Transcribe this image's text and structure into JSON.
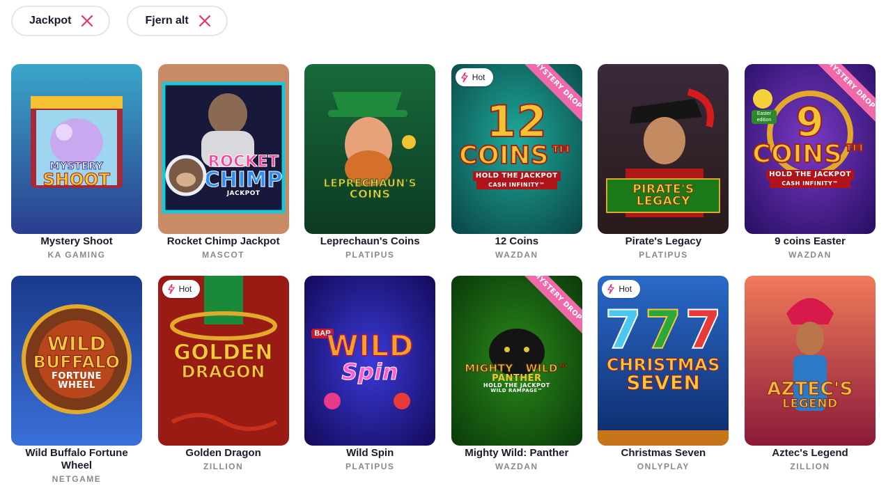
{
  "filters": [
    {
      "label": "Jackpot",
      "icon": "close-icon"
    },
    {
      "label": "Fjern alt",
      "icon": "close-icon"
    }
  ],
  "colors": {
    "accent": "#e7326e",
    "hot_ribbon": "#f06aa9",
    "provider_text": "#8a8795"
  },
  "hot_label": "Hot",
  "games": [
    {
      "title": "Mystery Shoot",
      "provider": "KA GAMING",
      "logo": [
        "MYSTERY",
        "SHOOT"
      ],
      "hot": false,
      "mystery_drop": false
    },
    {
      "title": "Rocket Chimp Jackpot",
      "provider": "MASCOT",
      "logo": [
        "ROCKET",
        "CHIMP",
        "JACKPOT"
      ],
      "hot": false,
      "mystery_drop": false
    },
    {
      "title": "Leprechaun's Coins",
      "provider": "PLATIPUS",
      "logo": [
        "LEPRECHAUN'S",
        "COINS"
      ],
      "hot": false,
      "mystery_drop": false
    },
    {
      "title": "12 Coins",
      "provider": "WAZDAN",
      "logo": [
        "12",
        "COINS™",
        "HOLD THE JACKPOT",
        "CASH INFINITY™"
      ],
      "hot": true,
      "mystery_drop": true
    },
    {
      "title": "Pirate's Legacy",
      "provider": "PLATIPUS",
      "logo": [
        "PIRATE'S LEGACY"
      ],
      "hot": false,
      "mystery_drop": false
    },
    {
      "title": "9 coins Easter",
      "provider": "WAZDAN",
      "logo": [
        "9",
        "COINS™",
        "HOLD THE JACKPOT",
        "CASH INFINITY™",
        "Easter edition"
      ],
      "hot": false,
      "mystery_drop": true
    },
    {
      "title": "Wild Buffalo Fortune Wheel",
      "provider": "NETGAME",
      "logo": [
        "WILD",
        "BUFFALO",
        "FORTUNE",
        "WHEEL"
      ],
      "hot": false,
      "mystery_drop": false
    },
    {
      "title": "Golden Dragon",
      "provider": "ZILLION",
      "logo": [
        "GOLDEN",
        "DRAGON"
      ],
      "hot": true,
      "mystery_drop": false
    },
    {
      "title": "Wild Spin",
      "provider": "PLATIPUS",
      "logo": [
        "WILD",
        "Spin",
        "BAR"
      ],
      "hot": false,
      "mystery_drop": false
    },
    {
      "title": "Mighty Wild: Panther",
      "provider": "WAZDAN",
      "logo": [
        "MIGHTY",
        "WILD™",
        "PANTHER",
        "HOLD THE JACKPOT",
        "WILD RAMPAGE™"
      ],
      "hot": false,
      "mystery_drop": true
    },
    {
      "title": "Christmas Seven",
      "provider": "ONLYPLAY",
      "logo": [
        "7",
        "CHRISTMAS",
        "SEVEN"
      ],
      "hot": true,
      "mystery_drop": false
    },
    {
      "title": "Aztec's Legend",
      "provider": "ZILLION",
      "logo": [
        "AZTEC'S",
        "LEGEND"
      ],
      "hot": false,
      "mystery_drop": false
    }
  ],
  "mystery_drop_label": "MYSTERY DROP"
}
